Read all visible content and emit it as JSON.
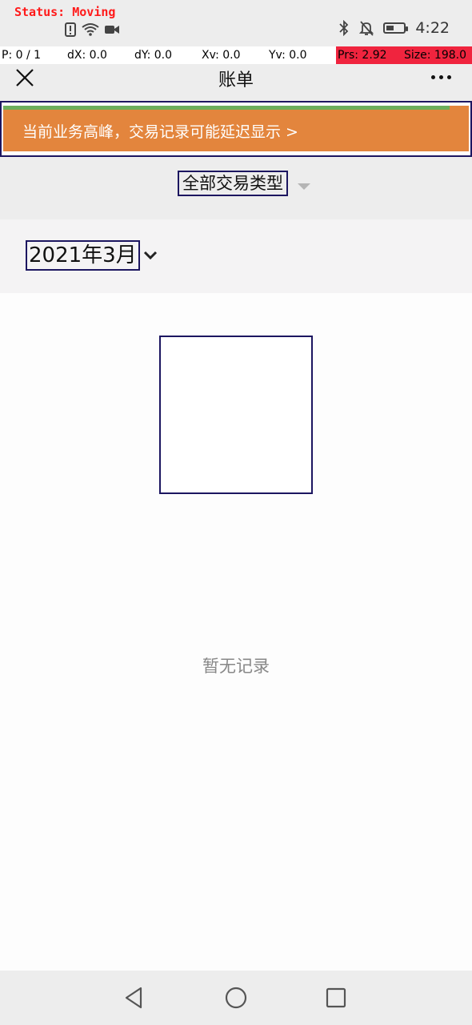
{
  "debug": {
    "status": "Status: Moving",
    "pointer": {
      "p": "P: 0 / 1",
      "dx": "dX: 0.0",
      "dy": "dY: 0.0",
      "xv": "Xv: 0.0",
      "yv": "Yv: 0.0",
      "prs": "Prs: 2.92",
      "size": "Size: 198.0"
    }
  },
  "statusbar": {
    "time": "4:22",
    "battery_level": 0.45,
    "icons": [
      "alert-icon",
      "wifi-icon",
      "video-camera-icon",
      "bluetooth-icon",
      "bell-off-icon",
      "battery-icon"
    ]
  },
  "header": {
    "title": "账单",
    "close_icon": "close-icon",
    "more_icon": "more-icon"
  },
  "banner": {
    "text": "当前业务高峰，交易记录可能延迟显示 >",
    "color": "#e3853d",
    "progress_color": "#6cae5c"
  },
  "filter": {
    "label": "全部交易类型"
  },
  "month": {
    "label": "2021年3月"
  },
  "empty": {
    "text": "暂无记录"
  },
  "colors": {
    "highlight_border": "#1c1660",
    "debug_red": "#f0243e"
  }
}
